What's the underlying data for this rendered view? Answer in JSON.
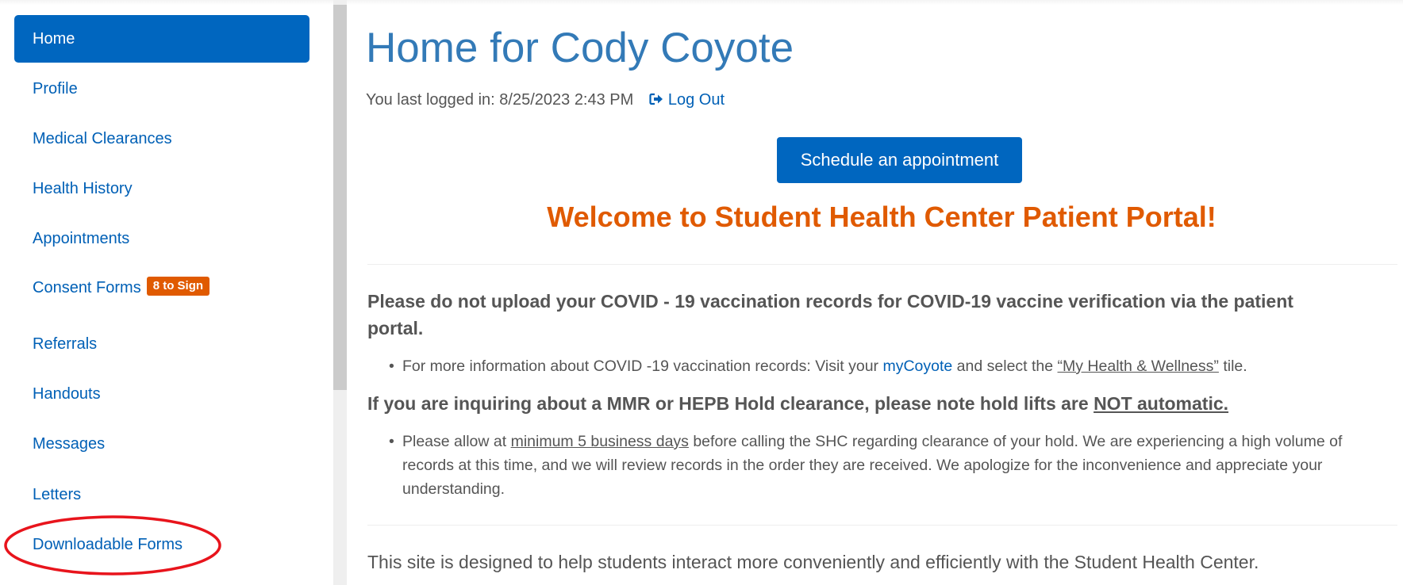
{
  "sidebar": {
    "items": [
      {
        "label": "Home",
        "active": true
      },
      {
        "label": "Profile"
      },
      {
        "label": "Medical Clearances"
      },
      {
        "label": "Health History"
      },
      {
        "label": "Appointments"
      },
      {
        "label": "Consent Forms",
        "badge": "8 to Sign"
      },
      {
        "label": "Referrals"
      },
      {
        "label": "Handouts"
      },
      {
        "label": "Messages"
      },
      {
        "label": "Letters"
      },
      {
        "label": "Downloadable Forms",
        "annotated": true
      }
    ]
  },
  "header": {
    "title": "Home for Cody Coyote",
    "last_login_label": "You last logged in: 8/25/2023 2:43 PM",
    "logout_label": "Log Out",
    "logout_icon": "sign-out-icon"
  },
  "schedule_button": "Schedule an appointment",
  "welcome": "Welcome to Student Health Center Patient Portal!",
  "notices": {
    "covid_heading": "Please do not upload your COVID - 19 vaccination records for COVID-19 vaccine verification via the patient portal.",
    "covid_bullet": {
      "prefix": "For more information about COVID -19 vaccination records: Visit your ",
      "link": "myCoyote",
      "middle": " and select the ",
      "underlined": "“My Health & Wellness”",
      "suffix": " tile."
    },
    "hold_heading": {
      "prefix": "If you are inquiring about a MMR or HEPB Hold clearance, please note hold lifts are ",
      "underlined": "NOT automatic."
    },
    "hold_bullet": {
      "prefix": "Please allow at ",
      "underlined": "minimum 5 business days",
      "suffix": " before calling the SHC regarding clearance of your hold. We are experiencing a high volume of records at this time, and we will review records in the order they are received. We apologize for the inconvenience and appreciate your understanding."
    }
  },
  "footer_text": "This site is designed to help students interact more conveniently and efficiently with the Student Health Center.",
  "colors": {
    "primary": "#0066bf",
    "link": "#0060b6",
    "title": "#337ab7",
    "accent_orange": "#e05a00",
    "annotation_red": "#e8141c"
  }
}
